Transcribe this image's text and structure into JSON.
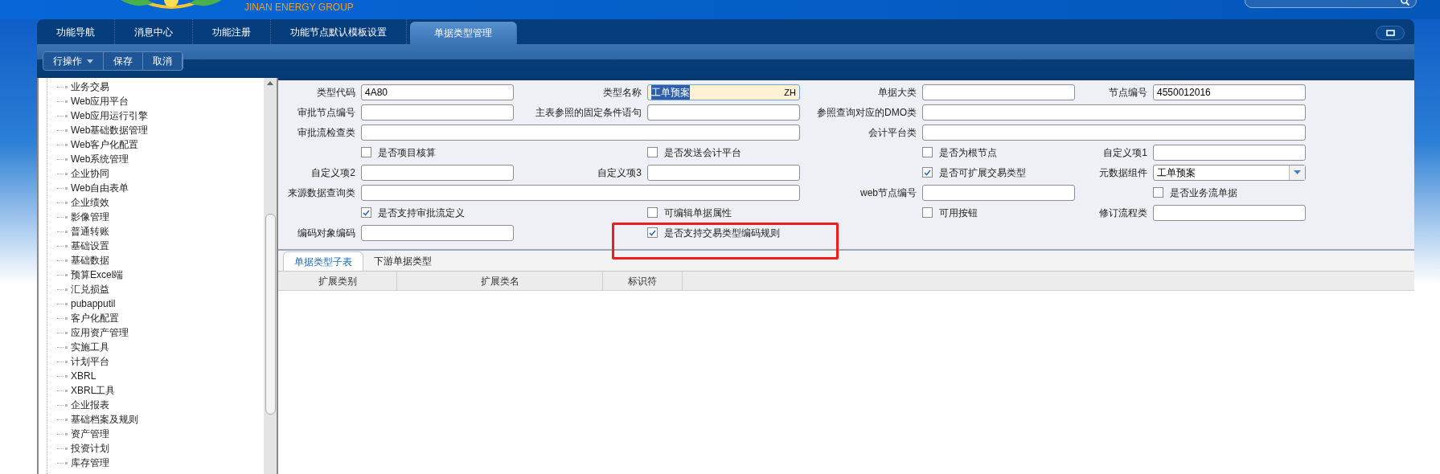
{
  "header": {
    "brand": "JINAN ENERGY GROUP"
  },
  "tabs": [
    {
      "label": "功能导航",
      "selected": false
    },
    {
      "label": "消息中心",
      "selected": false
    },
    {
      "label": "功能注册",
      "selected": false
    },
    {
      "label": "功能节点默认模板设置",
      "selected": false
    },
    {
      "label": "单据类型管理",
      "selected": true
    }
  ],
  "toolbar": [
    {
      "label": "行操作",
      "kind": "menu"
    },
    {
      "label": "保存",
      "kind": "button"
    },
    {
      "label": "取消",
      "kind": "button"
    }
  ],
  "sidebar": {
    "items": [
      "业务交易",
      "Web应用平台",
      "Web应用运行引擎",
      "Web基础数据管理",
      "Web客户化配置",
      "Web系统管理",
      "企业协同",
      "Web自由表单",
      "企业绩效",
      "影像管理",
      "普通转账",
      "基础设置",
      "基础数据",
      "预算Excel端",
      "汇兑损益",
      "pubapputil",
      "客户化配置",
      "应用资产管理",
      "实施工具",
      "计划平台",
      "XBRL",
      "XBRL工具",
      "企业报表",
      "基础档案及规则",
      "资产管理",
      "投资计划",
      "库存管理"
    ]
  },
  "form": {
    "rows": [
      [
        {
          "kind": "field",
          "label": "类型代码",
          "value": "4A80"
        },
        {
          "kind": "lang_field",
          "label": "类型名称",
          "value": "工单预案",
          "lang": "ZH",
          "text_selected": true
        },
        {
          "kind": "field",
          "label": "单据大类"
        },
        {
          "kind": "field",
          "label": "节点编号",
          "value": "4550012016"
        }
      ],
      [
        {
          "kind": "field",
          "label": "审批节点编号"
        },
        {
          "kind": "field",
          "label": "主表参照的固定条件语句"
        },
        {
          "kind": "wide_field",
          "label": "参照查询对应的DMO类"
        }
      ],
      [
        {
          "kind": "wide_field",
          "label": "审批流检查类"
        },
        {
          "kind": "wide_field",
          "label": "会计平台类"
        }
      ],
      [
        {
          "kind": "checkbox",
          "label": "是否项目核算",
          "checked": false
        },
        {
          "kind": "checkbox",
          "label": "是否发送会计平台",
          "checked": false
        },
        {
          "kind": "checkbox",
          "label": "是否为根节点",
          "checked": false
        },
        {
          "kind": "field",
          "label": "自定义项1"
        }
      ],
      [
        {
          "kind": "field",
          "label": "自定义项2"
        },
        {
          "kind": "field",
          "label": "自定义项3"
        },
        {
          "kind": "checkbox",
          "label": "是否可扩展交易类型",
          "checked": true
        },
        {
          "kind": "select",
          "label": "元数据组件",
          "value": "工单预案"
        }
      ],
      [
        {
          "kind": "wide_field",
          "label": "来源数据查询类"
        },
        {
          "kind": "field",
          "label": "web节点编号"
        },
        {
          "kind": "checkbox",
          "label": "是否业务流单据",
          "checked": false
        }
      ],
      [
        {
          "kind": "checkbox",
          "label": "是否支持审批流定义",
          "checked": true
        },
        {
          "kind": "checkbox",
          "label": "可编辑单据属性",
          "checked": false
        },
        {
          "kind": "checkbox",
          "label": "可用按钮",
          "checked": false
        },
        {
          "kind": "field",
          "label": "修订流程类"
        }
      ],
      [
        {
          "kind": "field",
          "label": "编码对象编码"
        },
        {
          "kind": "checkbox",
          "label": "是否支持交易类型编码规则",
          "checked": true,
          "highlighted": true
        }
      ]
    ]
  },
  "subtabs": [
    {
      "label": "单据类型子表",
      "selected": true
    },
    {
      "label": "下游单据类型",
      "selected": false
    }
  ],
  "table": {
    "columns": [
      "扩展类别",
      "扩展类名",
      "标识符"
    ]
  }
}
